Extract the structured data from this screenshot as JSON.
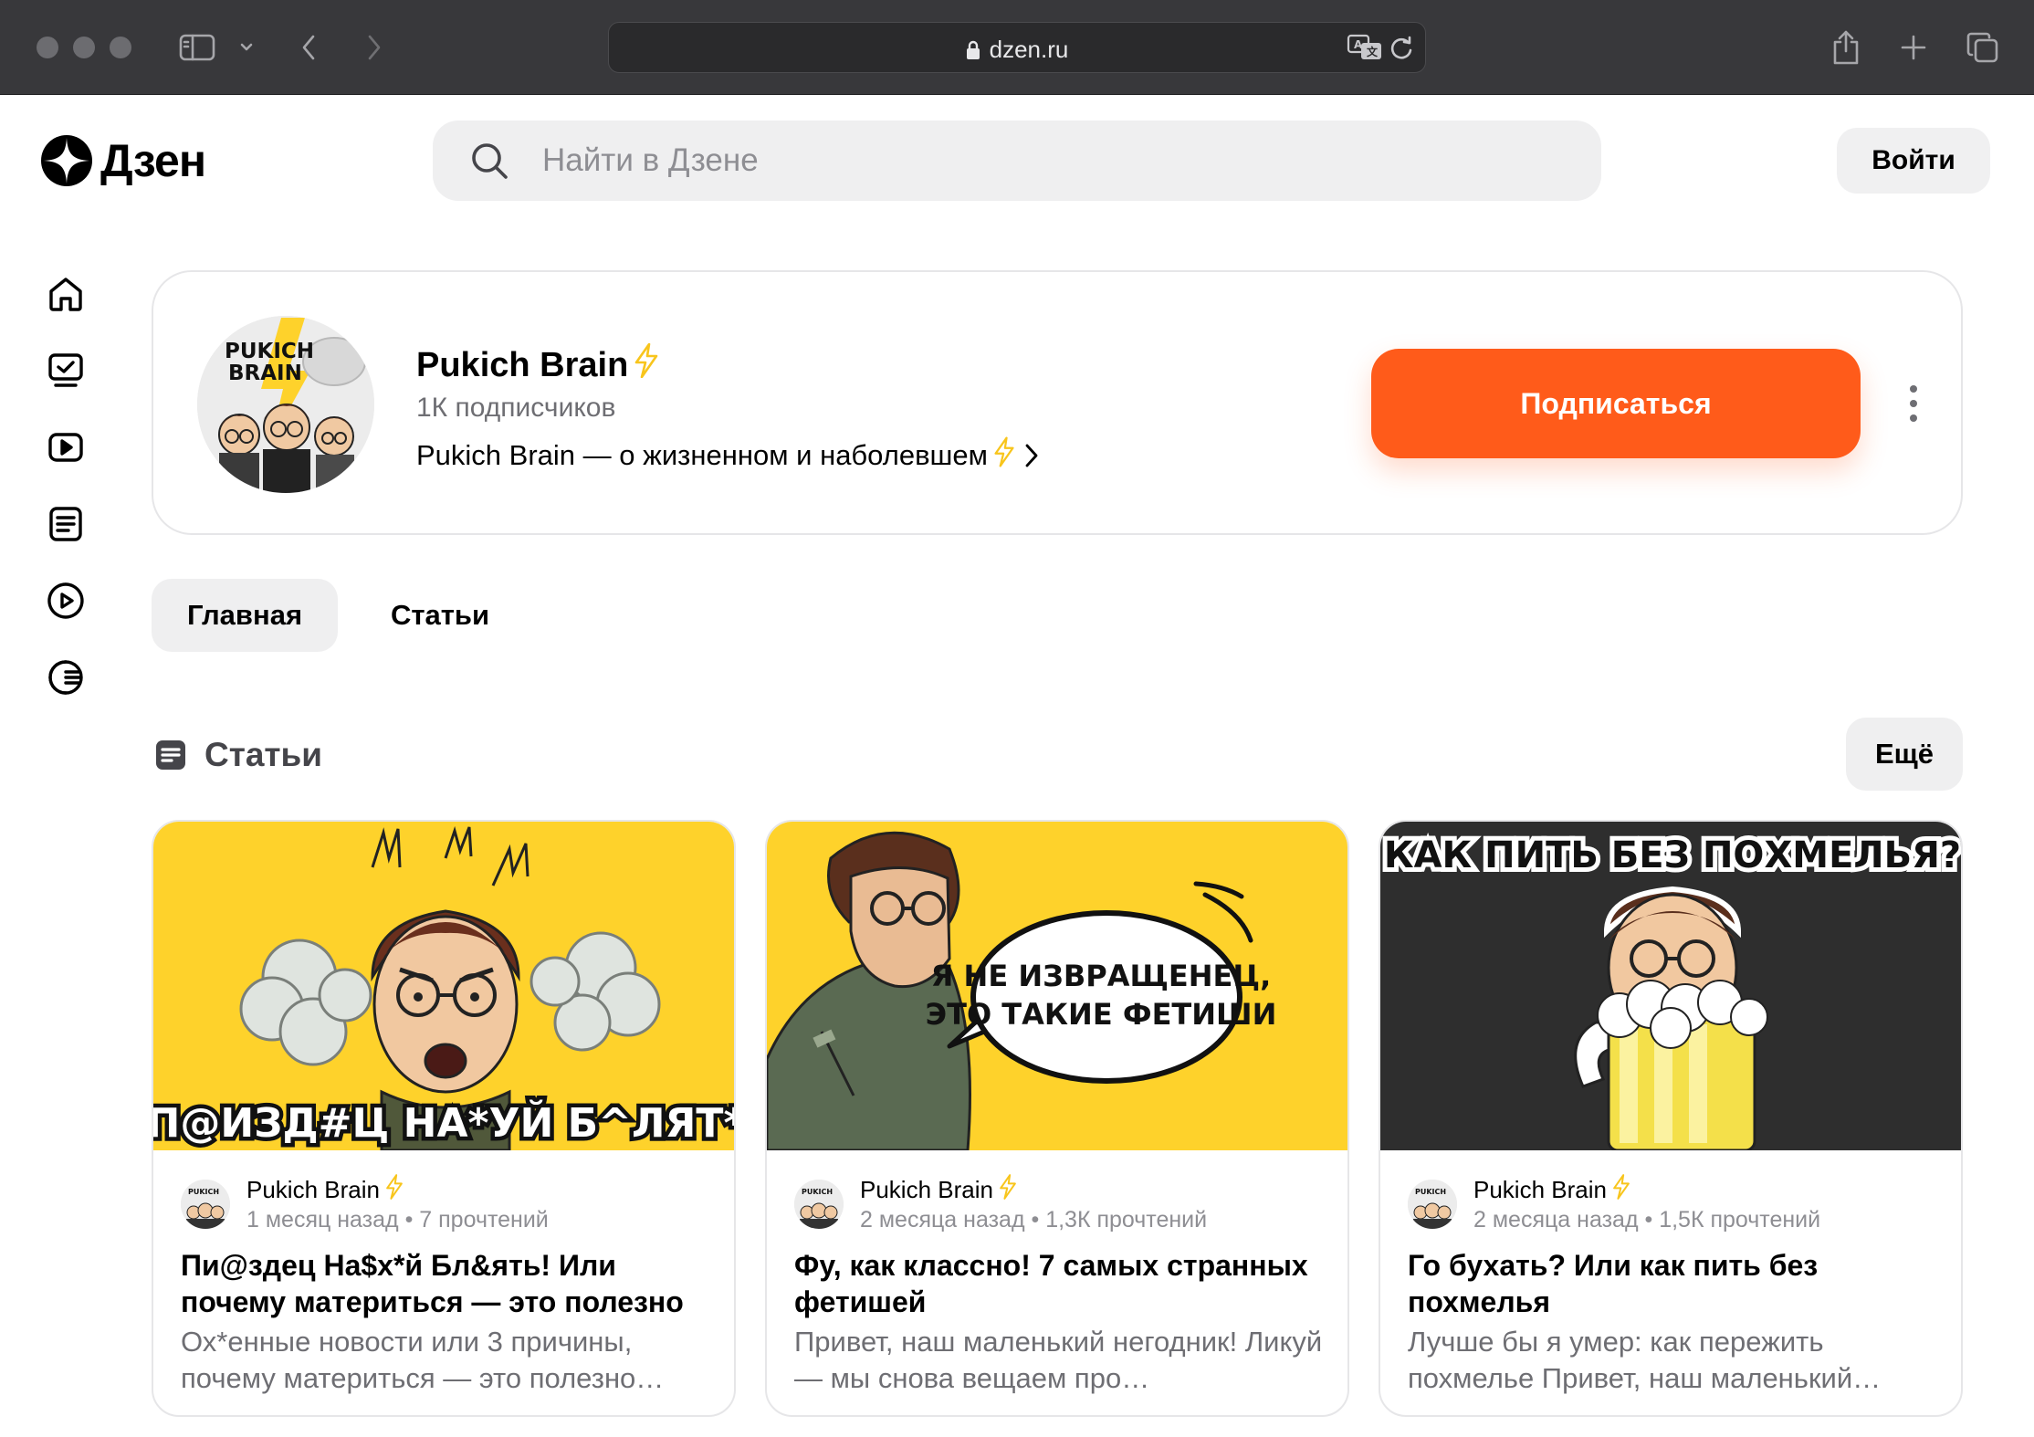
{
  "browser": {
    "url": "dzen.ru"
  },
  "header": {
    "logo_text": "Дзен",
    "search_placeholder": "Найти в Дзене",
    "login_label": "Войти"
  },
  "channel": {
    "name": "Pukich Brain",
    "subscribers": "1К подписчиков",
    "description": "Pukich Brain — о жизненном и наболевшем",
    "subscribe_label": "Подписаться",
    "avatar_text_line1": "PUKICH",
    "avatar_text_line2": "BRAIN"
  },
  "tabs": [
    {
      "label": "Главная",
      "active": true
    },
    {
      "label": "Статьи",
      "active": false
    }
  ],
  "section": {
    "title": "Статьи",
    "more_label": "Ещё"
  },
  "articles": [
    {
      "author": "Pukich Brain",
      "age": "1 месяц назад",
      "reads": "7 прочтений",
      "title": "Пи@здец На$х*й Бл&ять! Или почему материться — это полезно",
      "snippet": "Ох*енные новости или 3 причины, почему материться — это полезно…",
      "image_caption": "П@ИЗД#Ц НА*УЙ Б^ЛЯТ*",
      "image_bg": "#fed22b"
    },
    {
      "author": "Pukich Brain",
      "age": "2 месяца назад",
      "reads": "1,3К прочтений",
      "title": "Фу, как классно! 7 самых странных фетишей",
      "snippet": "Привет, наш маленький негодник! Ликуй — мы снова вещаем про…",
      "image_bubble_line1": "Я НЕ ИЗВРАЩЕНЕЦ,",
      "image_bubble_line2": "ЭТО ТАКИЕ ФЕТИШИ",
      "image_bg": "#fed22b"
    },
    {
      "author": "Pukich Brain",
      "age": "2 месяца назад",
      "reads": "1,5К прочтений",
      "title": "Го бухать? Или как пить без похмелья",
      "snippet": "Лучше бы я умер: как пережить похмелье Привет, наш маленький…",
      "image_caption": "КАК ПИТЬ БЕЗ ПОХМЕЛЬЯ?",
      "image_bg": "#2e2e2e"
    }
  ],
  "colors": {
    "accent": "#ff5b1a",
    "bolt": "#f8c51c",
    "chrome": "#38383b"
  }
}
